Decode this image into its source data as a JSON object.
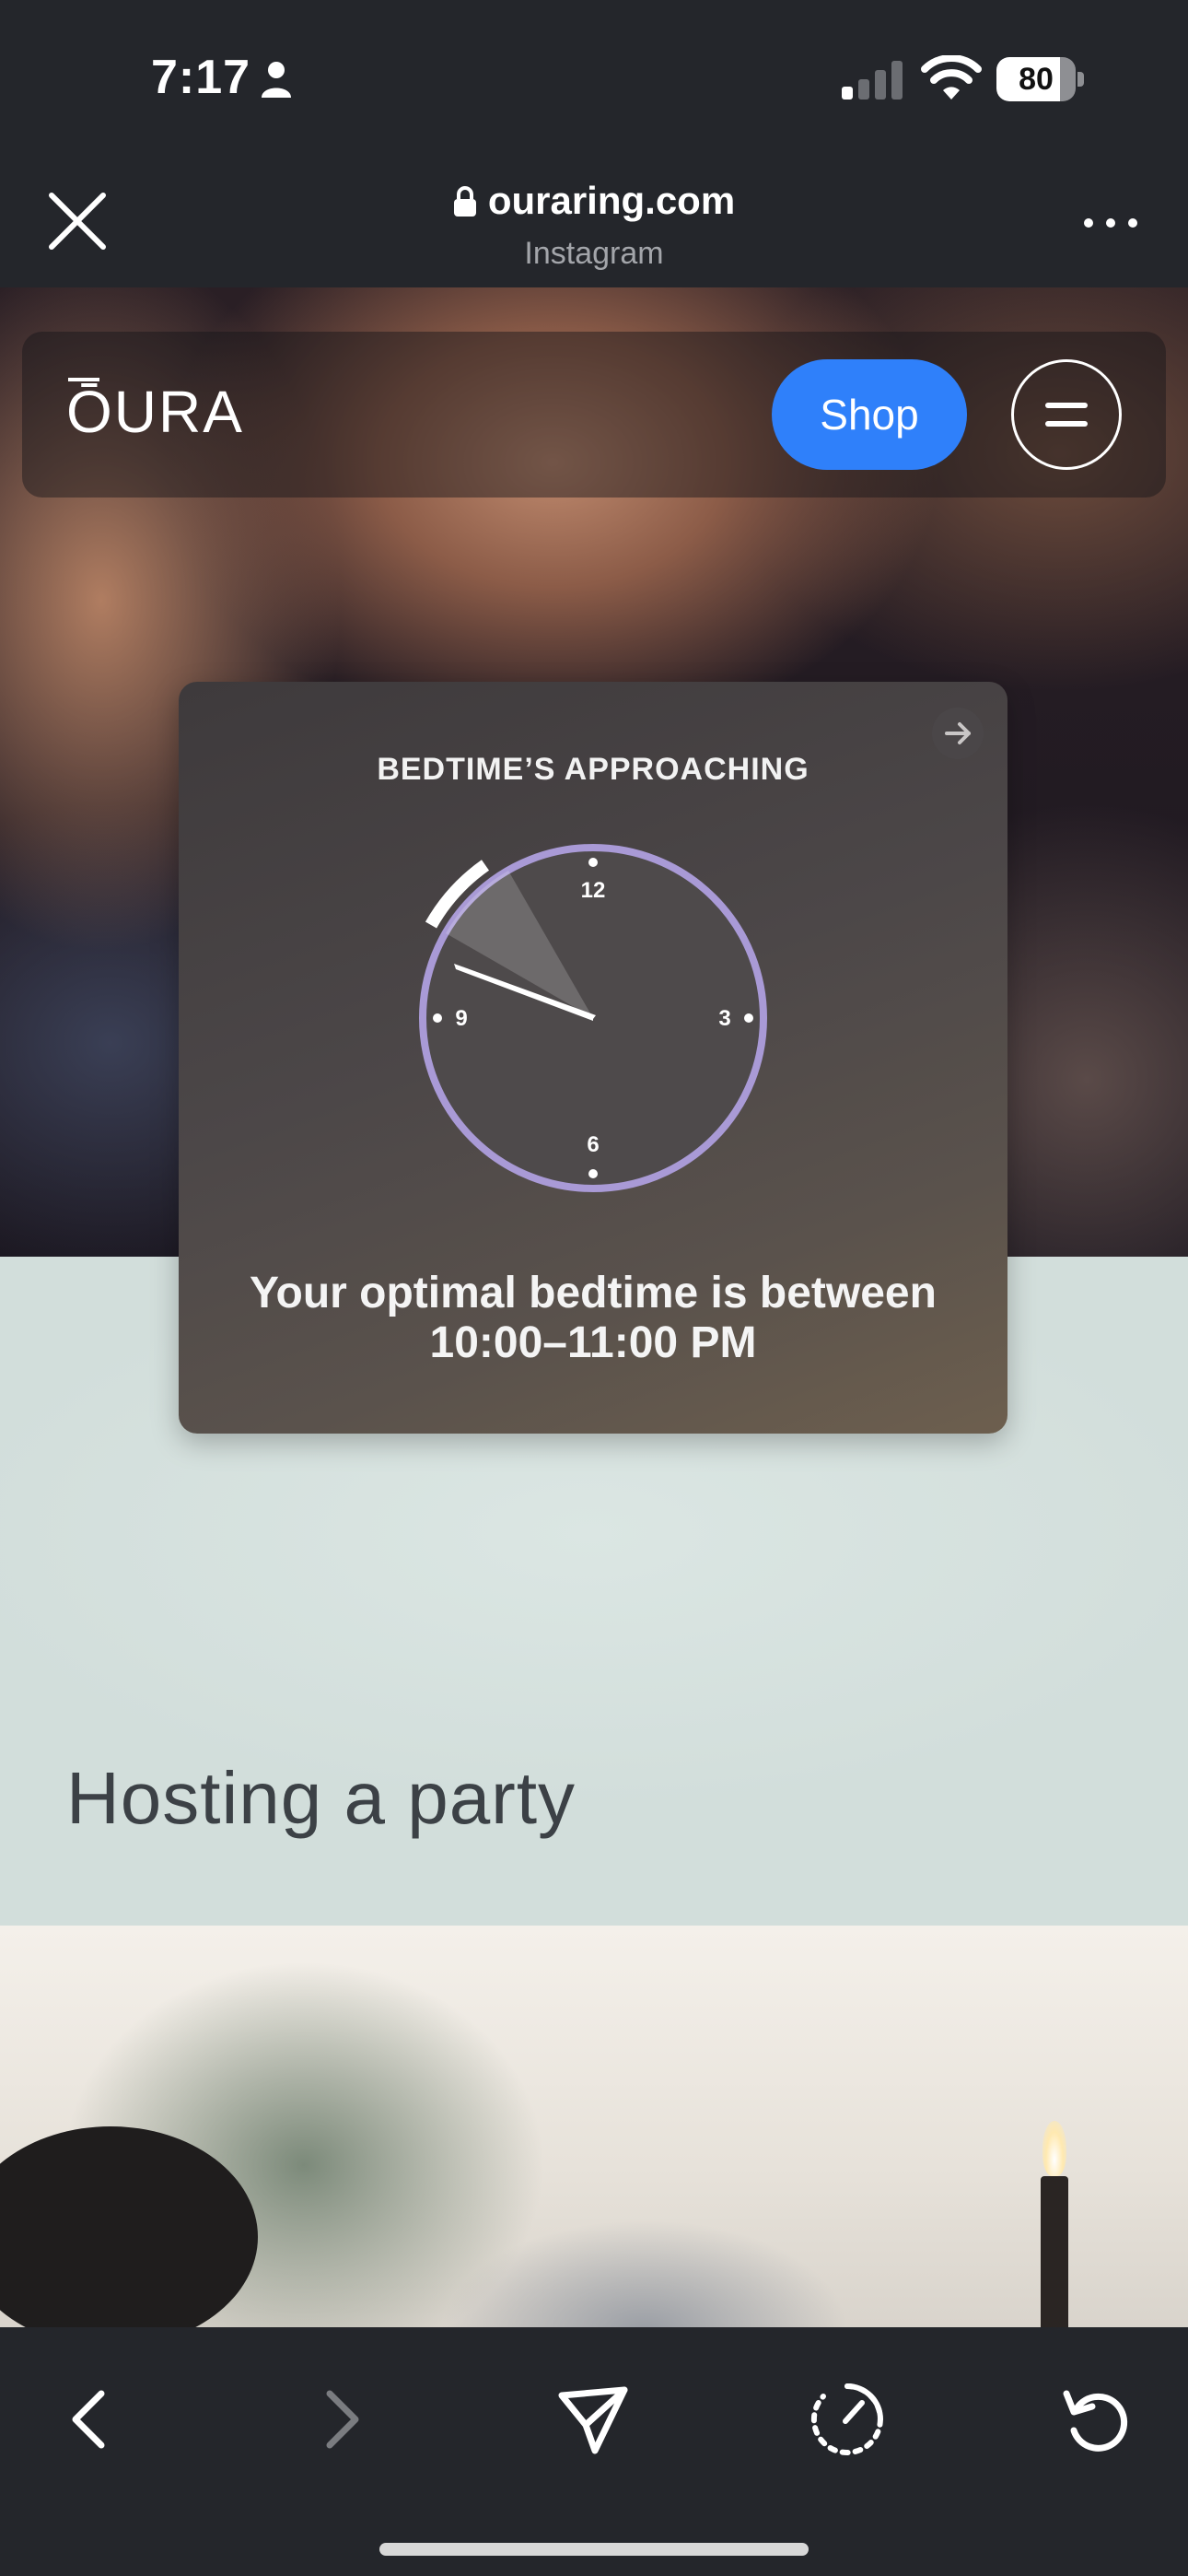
{
  "status_bar": {
    "time": "7:17",
    "battery_level": "80",
    "battery_fraction": 0.8,
    "icons": [
      "person-icon",
      "cellular-signal-icon",
      "wifi-icon",
      "battery-icon"
    ]
  },
  "browser": {
    "url": "ouraring.com",
    "source": "Instagram",
    "icons": [
      "close-icon",
      "lock-icon",
      "more-icon"
    ]
  },
  "site": {
    "logo": "ŌURA",
    "shop_label": "Shop",
    "menu_icon": "menu-icon"
  },
  "bedtime_card": {
    "eyebrow": "BEDTIME’S APPROACHING",
    "clock_labels": {
      "twelve": "12",
      "three": "3",
      "six": "6",
      "nine": "9"
    },
    "message_line1": "Your optimal bedtime is between",
    "message_line2": "10:00–11:00 PM",
    "arrow_icon": "arrow-right-icon"
  },
  "section": {
    "heading": "Hosting a party"
  },
  "toolbar": {
    "icons": [
      "back-icon",
      "forward-icon",
      "share-icon",
      "speed-icon",
      "reload-icon"
    ]
  },
  "colors": {
    "chrome_bg": "#24262b",
    "shop_blue": "#2f80fa",
    "clock_ring": "#a99ad6",
    "mint_bg": "#d3dfdc"
  }
}
